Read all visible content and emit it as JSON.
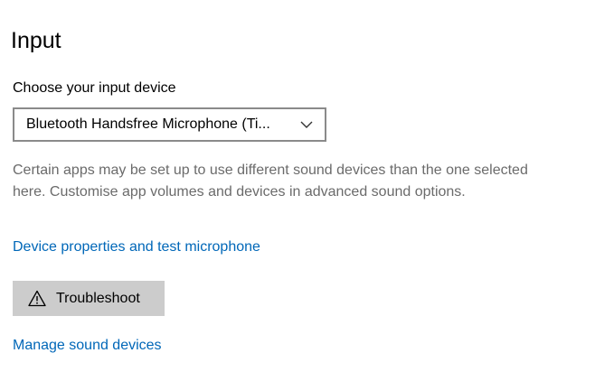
{
  "section": {
    "title": "Input"
  },
  "input_device": {
    "label": "Choose your input device",
    "selected": "Bluetooth Handsfree Microphone (Ti...",
    "chevron_icon": "chevron-down-icon"
  },
  "help_text": "Certain apps may be set up to use different sound devices than the one selected here. Customise app volumes and devices in advanced sound options.",
  "links": {
    "device_properties": "Device properties and test microphone",
    "manage_devices": "Manage sound devices"
  },
  "troubleshoot": {
    "label": "Troubleshoot",
    "icon": "warning-icon"
  },
  "colors": {
    "link": "#0067b8",
    "help_text": "#6b6b6b",
    "button_bg": "#cccccc",
    "dropdown_border": "#8a8a8a"
  }
}
